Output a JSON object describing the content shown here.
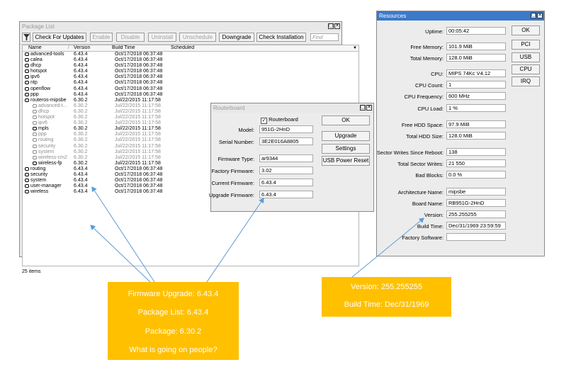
{
  "package_list": {
    "title": "Package List",
    "toolbar": {
      "check_updates": "Check For Updates",
      "enable": "Enable",
      "disable": "Disable",
      "uninstall": "Uninstall",
      "unschedule": "Unschedule",
      "downgrade": "Downgrade",
      "check_installation": "Check Installation",
      "find_placeholder": "Find"
    },
    "columns": {
      "name": "Name",
      "version": "Version",
      "build_time": "Build Time",
      "scheduled": "Scheduled"
    },
    "rows": [
      {
        "name": "advanced-tools",
        "version": "6.43.4",
        "build": "Oct/17/2018 06:37:48"
      },
      {
        "name": "calea",
        "version": "6.43.4",
        "build": "Oct/17/2018 06:37:48"
      },
      {
        "name": "dhcp",
        "version": "6.43.4",
        "build": "Oct/17/2018 06:37:48"
      },
      {
        "name": "hotspot",
        "version": "6.43.4",
        "build": "Oct/17/2018 06:37:48"
      },
      {
        "name": "ipv6",
        "version": "6.43.4",
        "build": "Oct/17/2018 06:37:48"
      },
      {
        "name": "ntp",
        "version": "6.43.4",
        "build": "Oct/17/2018 06:37:48"
      },
      {
        "name": "openflow",
        "version": "6.43.4",
        "build": "Oct/17/2018 06:37:48"
      },
      {
        "name": "ppp",
        "version": "6.43.4",
        "build": "Oct/17/2018 06:37:48"
      },
      {
        "name": "routeros-mipsbe",
        "version": "6.30.2",
        "build": "Jul/22/2015 11:17:58"
      },
      {
        "name": "advanced-t...",
        "version": "6.30.2",
        "build": "Jul/22/2015 11:17:58"
      },
      {
        "name": "dhcp",
        "version": "6.30.2",
        "build": "Jul/22/2015 11:17:58"
      },
      {
        "name": "hotspot",
        "version": "6.30.2",
        "build": "Jul/22/2015 11:17:58"
      },
      {
        "name": "ipv6",
        "version": "6.30.2",
        "build": "Jul/22/2015 11:17:58"
      },
      {
        "name": "mpls",
        "version": "6.30.2",
        "build": "Jul/22/2015 11:17:58"
      },
      {
        "name": "ppp",
        "version": "6.30.2",
        "build": "Jul/22/2015 11:17:58"
      },
      {
        "name": "routing",
        "version": "6.30.2",
        "build": "Jul/22/2015 11:17:58"
      },
      {
        "name": "security",
        "version": "6.30.2",
        "build": "Jul/22/2015 11:17:58"
      },
      {
        "name": "system",
        "version": "6.30.2",
        "build": "Jul/22/2015 11:17:58"
      },
      {
        "name": "wireless-cm2",
        "version": "6.30.2",
        "build": "Jul/22/2015 11:17:58"
      },
      {
        "name": "wireless-fp",
        "version": "6.30.2",
        "build": "Jul/22/2015 11:17:58"
      },
      {
        "name": "routing",
        "version": "6.43.4",
        "build": "Oct/17/2018 06:37:48"
      },
      {
        "name": "security",
        "version": "6.43.4",
        "build": "Oct/17/2018 06:37:48"
      },
      {
        "name": "system",
        "version": "6.43.4",
        "build": "Oct/17/2018 06:37:48"
      },
      {
        "name": "user-manager",
        "version": "6.43.4",
        "build": "Oct/17/2018 06:37:48"
      },
      {
        "name": "wireless",
        "version": "6.43.4",
        "build": "Oct/17/2018 06:37:48"
      }
    ],
    "status": "25 items"
  },
  "routerboard": {
    "title": "Routerboard",
    "checkbox_label": "Routerboard",
    "model_label": "Model:",
    "model": "951G-2HnD",
    "serial_label": "Serial Number:",
    "serial": "3E2E016A8805",
    "fw_type_label": "Firmware Type:",
    "fw_type": "ar9344",
    "factory_fw_label": "Factory Firmware:",
    "factory_fw": "3.02",
    "current_fw_label": "Current Firmware:",
    "current_fw": "6.43.4",
    "upgrade_fw_label": "Upgrade Firmware:",
    "upgrade_fw": "6.43.4",
    "buttons": {
      "ok": "OK",
      "upgrade": "Upgrade",
      "settings": "Settings",
      "usb_reset": "USB Power Reset"
    }
  },
  "resources": {
    "title": "Resources",
    "fields": [
      {
        "label": "Uptime:",
        "value": "00:05:42"
      },
      {
        "label": "Free Memory:",
        "value": "101.9 MiB"
      },
      {
        "label": "Total Memory:",
        "value": "128.0 MiB"
      },
      {
        "label": "CPU:",
        "value": "MIPS 74Kc V4.12"
      },
      {
        "label": "CPU Count:",
        "value": "1"
      },
      {
        "label": "CPU Frequency:",
        "value": "600 MHz"
      },
      {
        "label": "CPU Load:",
        "value": "1 %"
      },
      {
        "label": "Free HDD Space:",
        "value": "97.9 MiB"
      },
      {
        "label": "Total HDD Size:",
        "value": "128.0 MiB"
      },
      {
        "label": "Sector Writes Since Reboot:",
        "value": "138"
      },
      {
        "label": "Total Sector Writes:",
        "value": "21 550"
      },
      {
        "label": "Bad Blocks:",
        "value": "0.0 %"
      },
      {
        "label": "Architecture Name:",
        "value": "mipsbe"
      },
      {
        "label": "Board Name:",
        "value": "RB951G-2HnD"
      },
      {
        "label": "Version:",
        "value": "255.255255"
      },
      {
        "label": "Build Time:",
        "value": "Dec/31/1969 23:59:59"
      },
      {
        "label": "Factory Software:",
        "value": ""
      }
    ],
    "buttons": {
      "ok": "OK",
      "pci": "PCI",
      "usb": "USB",
      "cpu": "CPU",
      "irq": "IRQ"
    }
  },
  "callouts": {
    "left": [
      "Firmware Upgrade: 6.43.4",
      "Package List: 6.43.4",
      "Package: 6.30.2",
      "What is going on people?"
    ],
    "right": [
      "Version: 255.255255",
      "Build Time: Dec/31/1969"
    ]
  },
  "colors": {
    "callout": "#ffc000",
    "arrow": "#5b9bd5",
    "active_title": "#3b79c9"
  }
}
